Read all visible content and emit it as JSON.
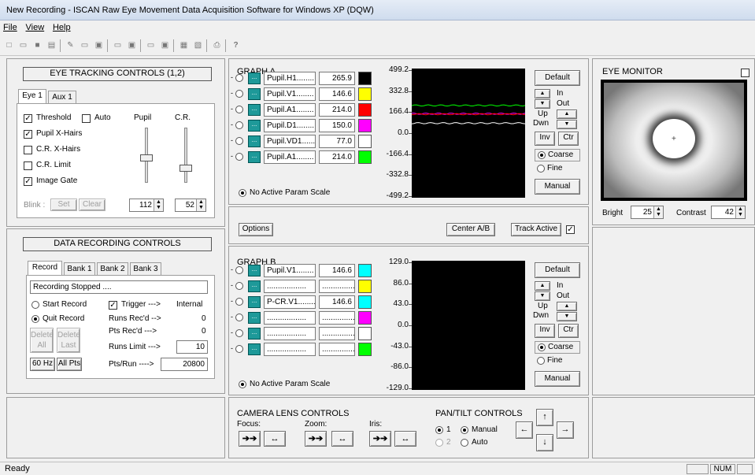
{
  "window": {
    "title": "New Recording - ISCAN Raw Eye Movement Data Acquisition Software for Windows XP (DQW)"
  },
  "menu": [
    "File",
    "View",
    "Help"
  ],
  "eye_tracking": {
    "header": "EYE TRACKING CONTROLS (1,2)",
    "tabs": [
      "Eye 1",
      "Aux 1"
    ],
    "threshold": "Threshold",
    "auto": "Auto",
    "pupil": "Pupil",
    "cr": "C.R.",
    "pupil_xhairs": "Pupil X-Hairs",
    "cr_xhairs": "C.R. X-Hairs",
    "cr_limit": "C.R. Limit",
    "image_gate": "Image Gate",
    "blink": "Blink :",
    "set": "Set",
    "clear": "Clear",
    "pupil_val": "112",
    "cr_val": "52",
    "pupil_slider": 0.55,
    "cr_slider": 0.75
  },
  "data_recording": {
    "header": "DATA RECORDING CONTROLS",
    "tabs": [
      "Record",
      "Bank 1",
      "Bank 2",
      "Bank 3"
    ],
    "status": "Recording Stopped ....",
    "start": "Start Record",
    "quit": "Quit Record",
    "trigger": "Trigger --->",
    "trigger_val": "Internal",
    "runs_recd": "Runs Rec'd -->",
    "runs_recd_val": "0",
    "pts_recd": "Pts Rec'd --->",
    "pts_recd_val": "0",
    "runs_limit": "Runs Limit --->",
    "runs_limit_val": "10",
    "pts_run": "Pts/Run ---->",
    "pts_run_val": "20800",
    "delete_all_1": "Delete",
    "delete_all_2": "All",
    "delete_last_1": "Delete",
    "delete_last_2": "Last",
    "hz": "60 Hz",
    "allpts": "All Pts"
  },
  "graph_a": {
    "title": "GRAPH A",
    "rows": [
      {
        "name": "Pupil.H1........",
        "val": "265.9",
        "color": "#000000"
      },
      {
        "name": "Pupil.V1........",
        "val": "146.6",
        "color": "#ffff00"
      },
      {
        "name": "Pupil.A1........",
        "val": "214.0",
        "color": "#ff0000"
      },
      {
        "name": "Pupil.D1........",
        "val": "150.0",
        "color": "#ff00ff"
      },
      {
        "name": "Pupil.VD1.......",
        "val": "77.0",
        "color": "#ffffff"
      },
      {
        "name": "Pupil.A1........",
        "val": "214.0",
        "color": "#00ff00"
      }
    ],
    "no_active": "No Active Param Scale",
    "yticks": [
      "499.2",
      "332.8",
      "166.4",
      "0.0",
      "-166.4",
      "-332.8",
      "-499.2"
    ],
    "ylim": [
      -499.2,
      499.2
    ],
    "traces": [
      {
        "color": "#00ff00",
        "y": 214.0
      },
      {
        "color": "#ff00ff",
        "y": 150.0
      },
      {
        "color": "#ff0000",
        "y": 146.6
      },
      {
        "color": "#ffffff",
        "y": 77.0
      }
    ]
  },
  "graph_b": {
    "title": "GRAPH B",
    "rows": [
      {
        "name": "Pupil.V1........",
        "val": "146.6",
        "color": "#00ffff"
      },
      {
        "name": "..................",
        "val": "...................",
        "color": "#ffff00"
      },
      {
        "name": "P-CR.V1........",
        "val": "146.6",
        "color": "#00ffff"
      },
      {
        "name": "..................",
        "val": "...................",
        "color": "#ff00ff"
      },
      {
        "name": "..................",
        "val": "...................",
        "color": "#ffffff"
      },
      {
        "name": "..................",
        "val": "...................",
        "color": "#00ff00"
      }
    ],
    "no_active": "No Active Param Scale",
    "yticks": [
      "129.0",
      "86.0",
      "43.0",
      "0.0",
      "-43.0",
      "-86.0",
      "-129.0"
    ]
  },
  "graph_controls": {
    "default": "Default",
    "in": "In",
    "out": "Out",
    "up": "Up",
    "dwn": "Dwn",
    "inv": "Inv",
    "ctr": "Ctr",
    "coarse": "Coarse",
    "fine": "Fine",
    "manual": "Manual"
  },
  "mid": {
    "options": "Options",
    "center": "Center A/B",
    "track": "Track Active"
  },
  "eye_monitor": {
    "title": "EYE MONITOR",
    "bright": "Bright",
    "bright_val": "25",
    "contrast": "Contrast",
    "contrast_val": "42"
  },
  "camera": {
    "title": "CAMERA LENS CONTROLS",
    "focus": "Focus:",
    "zoom": "Zoom:",
    "iris": "Iris:"
  },
  "pantilt": {
    "title": "PAN/TILT CONTROLS",
    "one": "1",
    "two": "2",
    "manual": "Manual",
    "auto": "Auto"
  },
  "status": {
    "text": "Ready",
    "num": "NUM"
  }
}
